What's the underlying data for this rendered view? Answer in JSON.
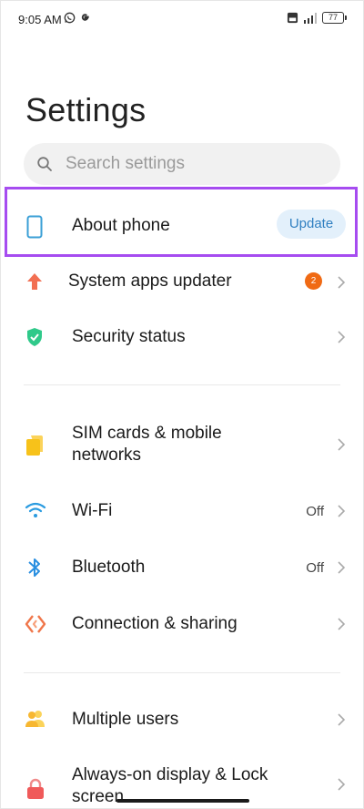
{
  "status_bar": {
    "time": "9:05 AM",
    "battery": "77"
  },
  "page": {
    "title": "Settings"
  },
  "search": {
    "placeholder": "Search settings"
  },
  "items": [
    {
      "label": "About phone",
      "action": "Update"
    },
    {
      "label": "System apps updater",
      "badge": "2"
    },
    {
      "label": "Security status"
    },
    {
      "label_line1": "SIM cards & mobile",
      "label_line2": "networks"
    },
    {
      "label": "Wi-Fi",
      "value": "Off"
    },
    {
      "label": "Bluetooth",
      "value": "Off"
    },
    {
      "label": "Connection & sharing"
    },
    {
      "label": "Multiple users"
    },
    {
      "label_line1": "Always-on display & Lock",
      "label_line2": "screen"
    }
  ],
  "colors": {
    "highlight": "#a64cf0",
    "badge": "#f06a14",
    "update_pill_bg": "#e3f0fb",
    "update_pill_text": "#2f7fc1",
    "phone_icon": "#3a9fd6",
    "updater_icon": "#f26f52",
    "security_icon": "#2fc98a",
    "sim_icon": "#f7c21a",
    "wifi_icon": "#2a9be0",
    "bluetooth_icon": "#2a8fe0",
    "connection_icon": "#f0764a",
    "users_icon": "#f7b731",
    "lock_icon": "#f05a5a"
  }
}
